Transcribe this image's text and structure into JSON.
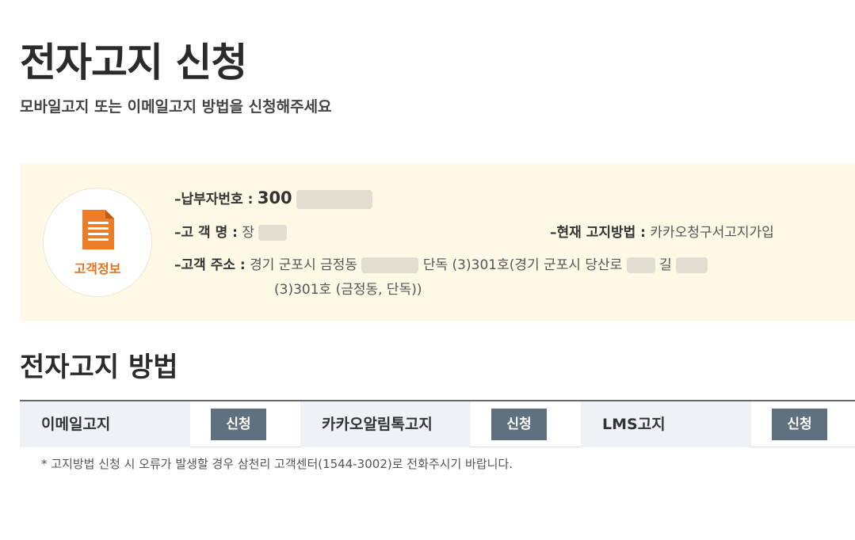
{
  "header": {
    "title": "전자고지 신청",
    "subtitle": "모바일고지 또는 이메일고지 방법을 신청해주세요"
  },
  "customer_info": {
    "icon_label": "고객정보",
    "payer_number_label": "납부자번호 :",
    "payer_number_value": "300",
    "name_label": "고 객 명 :",
    "name_value": "장",
    "current_method_label": "현재 고지방법 :",
    "current_method_value": "카카오청구서고지가입",
    "address_label": "고객 주소 :",
    "address_line1_a": "경기 군포시 금정동",
    "address_line1_b": "단독 (3)301호(경기 군포시 당산로",
    "address_line1_c": "길",
    "address_line2": "(3)301호 (금정동, 단독))"
  },
  "methods_section": {
    "title": "전자고지 방법",
    "items": [
      {
        "label": "이메일고지",
        "button": "신청"
      },
      {
        "label": "카카오알림톡고지",
        "button": "신청"
      },
      {
        "label": "LMS고지",
        "button": "신청"
      }
    ]
  },
  "notice": "* 고지방법 신청 시 오류가 발생할 경우 삼천리 고객센터(1544-3002)로 전화주시기 바랍니다.",
  "colors": {
    "info_bg": "#fef9e6",
    "accent_orange": "#e8711c",
    "button_bg": "#5f707e",
    "method_bg": "#eef2f7"
  }
}
